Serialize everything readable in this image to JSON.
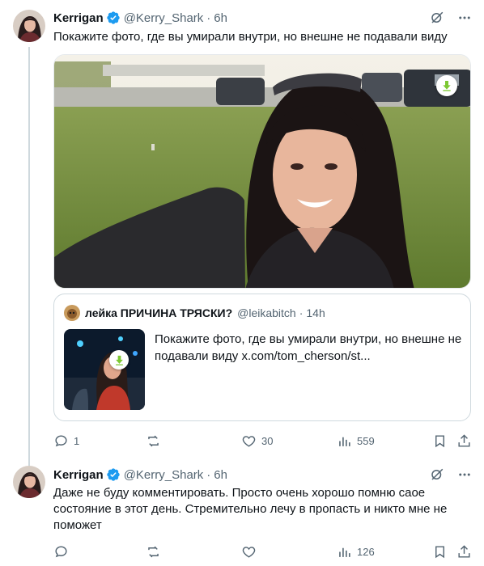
{
  "tweets": [
    {
      "author_name": "Kerrigan",
      "author_handle": "@Kerry_Shark",
      "separator": "·",
      "time": "6h",
      "text": "Покажите фото, где вы умирали внутри, но внешне не подавали виду",
      "quote": {
        "author_name": "лейка ПРИЧИНА ТРЯСКИ?",
        "author_handle": "@leikabitch",
        "separator": "·",
        "time": "14h",
        "text": "Покажите фото, где вы умирали внутри, но внешне не подавали виду ",
        "link": "x.com/tom_cherson/st..."
      },
      "actions": {
        "replies": "1",
        "retweets": "",
        "likes": "30",
        "views": "559"
      }
    },
    {
      "author_name": "Kerrigan",
      "author_handle": "@Kerry_Shark",
      "separator": "·",
      "time": "6h",
      "text": "Даже не буду комментировать. Просто очень хорошо помню саое состояние в этот день. Стремительно лечу в пропасть и никто мне не поможет",
      "actions": {
        "replies": "",
        "retweets": "",
        "likes": "",
        "views": "126"
      }
    }
  ],
  "icons": {
    "verified": "verified-badge-icon",
    "grok": "grok-icon",
    "more": "more-icon",
    "reply": "reply-icon",
    "retweet": "retweet-icon",
    "like": "like-icon",
    "views": "views-icon",
    "bookmark": "bookmark-icon",
    "share": "share-icon",
    "download": "download-icon"
  },
  "colors": {
    "text": "#0f1419",
    "secondary": "#536471",
    "verified": "#1d9bf0",
    "border": "#cfd9de",
    "download": "#7cc832"
  }
}
